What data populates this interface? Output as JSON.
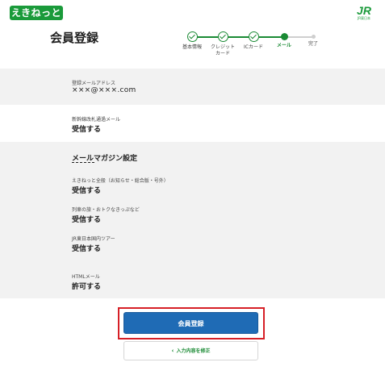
{
  "header": {
    "logo_text": "えきねっと",
    "jr_mark": "JR",
    "jr_sub": "JR東日本"
  },
  "page_title": "会員登録",
  "stepper": {
    "steps": [
      {
        "label": "基本情報",
        "state": "done"
      },
      {
        "label": "クレジット\nカード",
        "state": "done"
      },
      {
        "label": "ICカード",
        "state": "done"
      },
      {
        "label": "メール",
        "state": "current"
      },
      {
        "label": "完了",
        "state": "todo"
      }
    ]
  },
  "email_section": {
    "label": "登録メールアドレス",
    "value": "×××@×××.com"
  },
  "shinkansen_section": {
    "label": "新幹線改札通過メール",
    "value": "受信する"
  },
  "magazine_section": {
    "title": "メールマガジン設定",
    "items": [
      {
        "label": "えきねっと全般（お知らせ・総合版・号外）",
        "value": "受信する"
      },
      {
        "label": "列車の旅・おトクなきっぷなど",
        "value": "受信する"
      },
      {
        "label": "JR東日本国内ツアー",
        "value": "受信する"
      },
      {
        "label": "HTMLメール",
        "value": "許可する"
      }
    ]
  },
  "actions": {
    "register_label": "会員登録",
    "back_label": "入力内容を修正",
    "back_icon": "chevron-left-icon"
  },
  "colors": {
    "brand_green": "#1a8a34",
    "primary_blue": "#1f6bb5",
    "highlight_red": "#d61f26"
  }
}
